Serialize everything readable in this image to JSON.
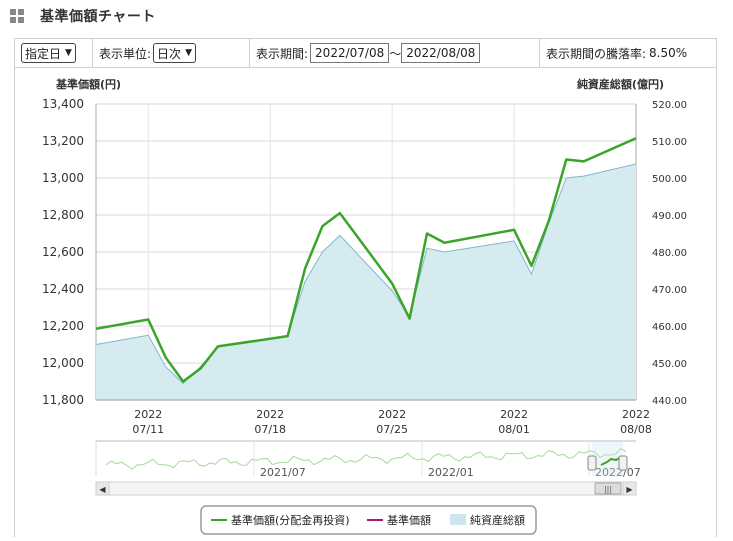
{
  "page": {
    "title": "基準価額チャート",
    "icon": "grid-icon"
  },
  "controls": {
    "range_select": "指定日",
    "unit_label": "表示単位:",
    "unit_select": "日次",
    "period_label": "表示期間:",
    "date_from": "2022/07/08",
    "date_sep": "〜",
    "date_to": "2022/08/08",
    "rate_label": "表示期間の騰落率:",
    "rate_value": "8.50%"
  },
  "chart_data": {
    "type": "line",
    "left_axis_title": "基準価額(円)",
    "right_axis_title": "純資産総額(億円)",
    "ylim_left": [
      11800,
      13400
    ],
    "yticks_left": [
      "13,400",
      "13,200",
      "13,000",
      "12,800",
      "12,600",
      "12,400",
      "12,200",
      "12,000",
      "11,800"
    ],
    "ylim_right": [
      440,
      520
    ],
    "yticks_right": [
      "520.00",
      "510.00",
      "500.00",
      "490.00",
      "480.00",
      "470.00",
      "460.00",
      "450.00",
      "440.00"
    ],
    "x_start": "2022-07-08",
    "x_end": "2022-08-08",
    "xticks": [
      {
        "date": "2022-07-11",
        "year": "2022",
        "md": "07/11"
      },
      {
        "date": "2022-07-18",
        "year": "2022",
        "md": "07/18"
      },
      {
        "date": "2022-07-25",
        "year": "2022",
        "md": "07/25"
      },
      {
        "date": "2022-08-01",
        "year": "2022",
        "md": "08/01"
      },
      {
        "date": "2022-08-08",
        "year": "2022",
        "md": "08/08"
      }
    ],
    "x": [
      "2022-07-08",
      "2022-07-11",
      "2022-07-12",
      "2022-07-13",
      "2022-07-14",
      "2022-07-15",
      "2022-07-19",
      "2022-07-20",
      "2022-07-21",
      "2022-07-22",
      "2022-07-25",
      "2022-07-26",
      "2022-07-27",
      "2022-07-28",
      "2022-08-01",
      "2022-08-02",
      "2022-08-03",
      "2022-08-04",
      "2022-08-05",
      "2022-08-08"
    ],
    "series": [
      {
        "name": "基準価額(分配金再投資)",
        "color": "#3aa52a",
        "axis": "left",
        "values": [
          12185,
          12235,
          12030,
          11900,
          11970,
          12090,
          12145,
          12510,
          12740,
          12810,
          12430,
          12240,
          12700,
          12650,
          12720,
          12525,
          12770,
          13100,
          13090,
          13215
        ]
      },
      {
        "name": "純資産総額",
        "color": "#7fb8cc",
        "fill": "#d6ebf0",
        "axis": "right",
        "values": [
          455.0,
          457.5,
          449.0,
          444.5,
          449.0,
          454.5,
          457.5,
          472.0,
          480.0,
          484.5,
          469.5,
          462.5,
          481.0,
          480.0,
          483.0,
          474.0,
          488.0,
          500.0,
          500.5,
          503.8
        ]
      }
    ],
    "legend": [
      {
        "label": "基準価額(分配金再投資)",
        "color": "#3aa52a",
        "kind": "line"
      },
      {
        "label": "基準価額",
        "color": "#b0147a",
        "kind": "line"
      },
      {
        "label": "純資産総額",
        "color": "#cfe6ee",
        "kind": "box"
      }
    ],
    "navigator_labels": [
      "2021/07",
      "2022/01",
      "2022/07"
    ],
    "grid": true
  }
}
